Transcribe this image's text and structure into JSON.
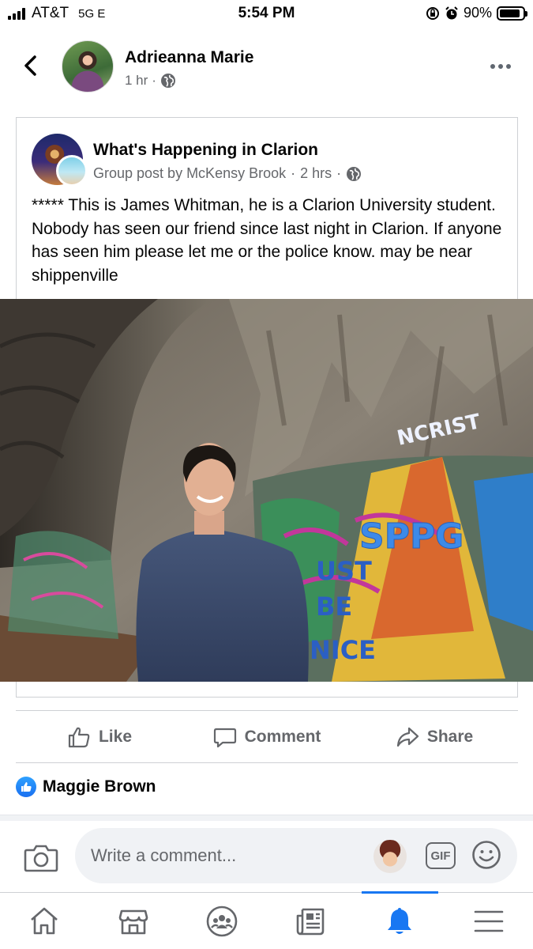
{
  "status_bar": {
    "carrier": "AT&T",
    "network": "5G E",
    "time": "5:54 PM",
    "battery": "90%",
    "battery_level": 0.9
  },
  "post": {
    "author": "Adrieanna Marie",
    "time": "1 hr",
    "privacy_icon": "globe-icon"
  },
  "shared_post": {
    "group_name": "What's Happening in Clarion",
    "meta": "Group post by McKensy Brook",
    "time": "2 hrs",
    "text": "***** This is James Whitman, he is a Clarion University student. Nobody has seen our friend since last night in Clarion. If anyone has seen him please let me or the police know. may be near shippenville"
  },
  "actions": {
    "like": "Like",
    "comment": "Comment",
    "share": "Share"
  },
  "reactions": {
    "names": "Maggie Brown"
  },
  "composer": {
    "placeholder": "Write a comment...",
    "gif_label": "GIF"
  },
  "bottom_nav": {
    "items": [
      "home-icon",
      "marketplace-icon",
      "groups-icon",
      "news-icon",
      "notifications-icon",
      "menu-icon"
    ],
    "active": "notifications-icon"
  },
  "colors": {
    "accent": "#1877f2",
    "secondary_text": "#65676b"
  }
}
